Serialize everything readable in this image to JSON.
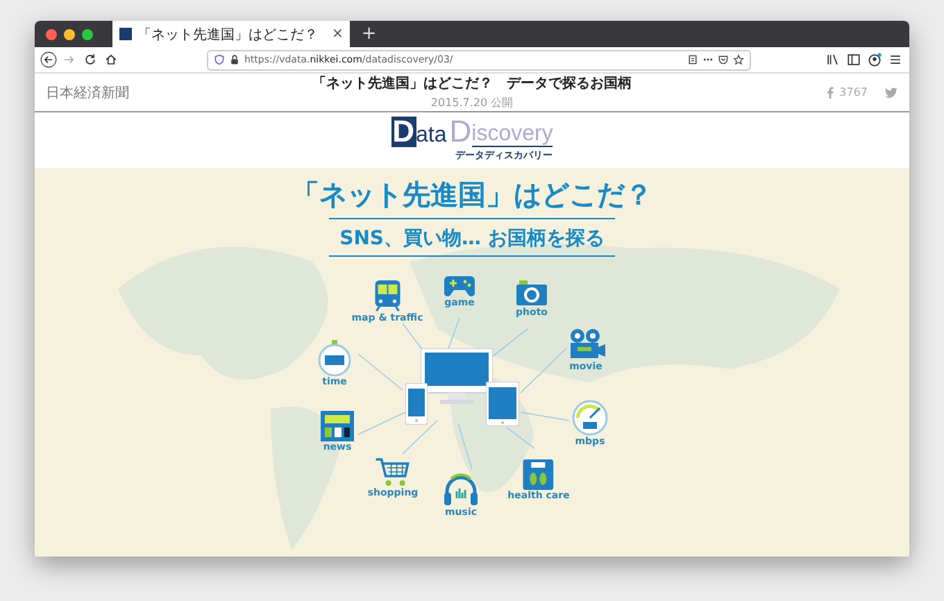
{
  "browser": {
    "tab": {
      "title": "「ネット先進国」はどこだ？",
      "selected": true
    },
    "new_tab": "+",
    "tab_close": "×",
    "url": {
      "host_pre": "https://vdata.",
      "host": "nikkei.com",
      "path": "/datadiscovery/03/"
    }
  },
  "header": {
    "brand": "日本経済新聞",
    "title": "「ネット先進国」はどこだ？　データで探るお国柄",
    "date": "2015.7.20 公開",
    "share_count": "3767"
  },
  "logo": {
    "first": "D",
    "first_rest": "ata",
    "second": "D",
    "second_rest": "iscovery",
    "subtitle": "データディスカバリー"
  },
  "hero": {
    "headline": "「ネット先進国」はどこだ？",
    "subheadline": "SNS、買い物… お国柄を探る"
  },
  "nodes": [
    {
      "kind": "train",
      "label": "map & traffic"
    },
    {
      "kind": "gamepad",
      "label": "game"
    },
    {
      "kind": "camera",
      "label": "photo"
    },
    {
      "kind": "stopwatch",
      "label": "time"
    },
    {
      "kind": "projector",
      "label": "movie"
    },
    {
      "kind": "newspaper",
      "label": "news"
    },
    {
      "kind": "gauge",
      "label": "mbps"
    },
    {
      "kind": "cart",
      "label": "shopping"
    },
    {
      "kind": "headphones",
      "label": "music"
    },
    {
      "kind": "scale",
      "label": "health care"
    }
  ]
}
